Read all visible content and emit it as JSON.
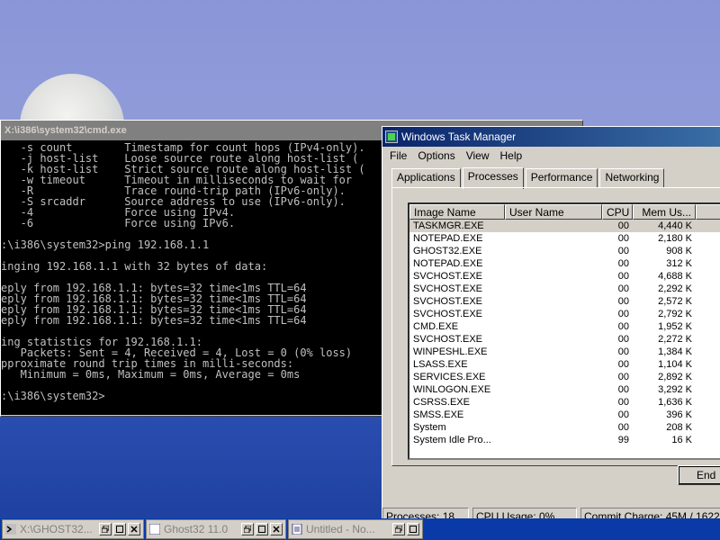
{
  "cmd_window": {
    "title": "X:\\i386\\system32\\cmd.exe",
    "console_lines": [
      "   -s count        Timestamp for count hops (IPv4-only).",
      "   -j host-list    Loose source route along host-list (",
      "   -k host-list    Strict source route along host-list (",
      "   -w timeout      Timeout in milliseconds to wait for ",
      "   -R              Trace round-trip path (IPv6-only).",
      "   -S srcaddr      Source address to use (IPv6-only).",
      "   -4              Force using IPv4.",
      "   -6              Force using IPv6.",
      "",
      ":\\i386\\system32>ping 192.168.1.1",
      "",
      "inging 192.168.1.1 with 32 bytes of data:",
      "",
      "eply from 192.168.1.1: bytes=32 time<1ms TTL=64",
      "eply from 192.168.1.1: bytes=32 time<1ms TTL=64",
      "eply from 192.168.1.1: bytes=32 time<1ms TTL=64",
      "eply from 192.168.1.1: bytes=32 time<1ms TTL=64",
      "",
      "ing statistics for 192.168.1.1:",
      "   Packets: Sent = 4, Received = 4, Lost = 0 (0% loss)",
      "pproximate round trip times in milli-seconds:",
      "   Minimum = 0ms, Maximum = 0ms, Average = 0ms",
      "",
      ":\\i386\\system32>"
    ]
  },
  "task_manager": {
    "title": "Windows Task Manager",
    "menu": [
      "File",
      "Options",
      "View",
      "Help"
    ],
    "tabs": [
      "Applications",
      "Processes",
      "Performance",
      "Networking"
    ],
    "active_tab": "Processes",
    "columns": [
      "Image Name",
      "User Name",
      "CPU",
      "Mem Us..."
    ],
    "processes": [
      {
        "name": "TASKMGR.EXE",
        "user": "",
        "cpu": "00",
        "mem": "4,440 K"
      },
      {
        "name": "NOTEPAD.EXE",
        "user": "",
        "cpu": "00",
        "mem": "2,180 K"
      },
      {
        "name": "GHOST32.EXE",
        "user": "",
        "cpu": "00",
        "mem": "908 K"
      },
      {
        "name": "NOTEPAD.EXE",
        "user": "",
        "cpu": "00",
        "mem": "312 K"
      },
      {
        "name": "SVCHOST.EXE",
        "user": "",
        "cpu": "00",
        "mem": "4,688 K"
      },
      {
        "name": "SVCHOST.EXE",
        "user": "",
        "cpu": "00",
        "mem": "2,292 K"
      },
      {
        "name": "SVCHOST.EXE",
        "user": "",
        "cpu": "00",
        "mem": "2,572 K"
      },
      {
        "name": "SVCHOST.EXE",
        "user": "",
        "cpu": "00",
        "mem": "2,792 K"
      },
      {
        "name": "CMD.EXE",
        "user": "",
        "cpu": "00",
        "mem": "1,952 K"
      },
      {
        "name": "SVCHOST.EXE",
        "user": "",
        "cpu": "00",
        "mem": "2,272 K"
      },
      {
        "name": "WINPESHL.EXE",
        "user": "",
        "cpu": "00",
        "mem": "1,384 K"
      },
      {
        "name": "LSASS.EXE",
        "user": "",
        "cpu": "00",
        "mem": "1,104 K"
      },
      {
        "name": "SERVICES.EXE",
        "user": "",
        "cpu": "00",
        "mem": "2,892 K"
      },
      {
        "name": "WINLOGON.EXE",
        "user": "",
        "cpu": "00",
        "mem": "3,292 K"
      },
      {
        "name": "CSRSS.EXE",
        "user": "",
        "cpu": "00",
        "mem": "1,636 K"
      },
      {
        "name": "SMSS.EXE",
        "user": "",
        "cpu": "00",
        "mem": "396 K"
      },
      {
        "name": "System",
        "user": "",
        "cpu": "00",
        "mem": "208 K"
      },
      {
        "name": "System Idle Pro...",
        "user": "",
        "cpu": "99",
        "mem": "16 K"
      }
    ],
    "end_button_label": "End",
    "status": {
      "processes": "Processes: 18",
      "cpu": "CPU Usage: 0%",
      "commit": "Commit Charge: 45M / 1622"
    }
  },
  "taskbar": {
    "items": [
      {
        "label": "X:\\GHOST32..."
      },
      {
        "label": "Ghost32 11.0"
      },
      {
        "label": "Untitled - No..."
      }
    ]
  },
  "colors": {
    "titlebar_active_start": "#0a246a",
    "titlebar_active_end": "#3a6ea5",
    "window_face": "#d4d0c8",
    "console_bg": "#000000",
    "console_fg": "#c0c0c0",
    "taskbar": "#0a3aa8"
  }
}
